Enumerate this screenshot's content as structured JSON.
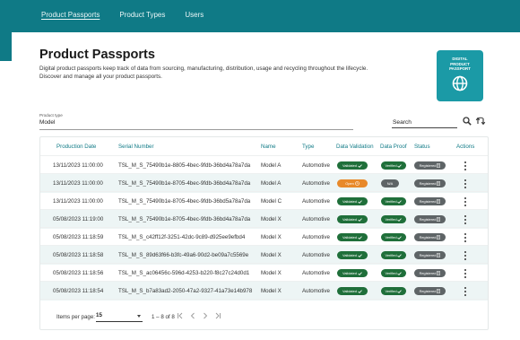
{
  "nav": {
    "items": [
      {
        "label": "Product Passports",
        "active": true
      },
      {
        "label": "Product Types",
        "active": false
      },
      {
        "label": "Users",
        "active": false
      }
    ]
  },
  "header": {
    "title": "Product Passports",
    "desc_line1": "Digital product passports keep track of data from sourcing, manufacturing, distribution, usage and recycling throughout the lifecycle.",
    "desc_line2": "Discover and manage all your product passports."
  },
  "badge": {
    "line1": "DIGITAL",
    "line2": "PRODUCT",
    "line3": "PASSPORT",
    "icon": "globe-icon"
  },
  "filter": {
    "label": "Product type",
    "value": "Model"
  },
  "search": {
    "placeholder": "Search",
    "search_icon": "search-icon",
    "refresh_icon": "refresh-icon"
  },
  "table": {
    "headers": [
      "Production Date",
      "Serial Number",
      "Name",
      "Type",
      "Data Validation",
      "Data Proof",
      "Status",
      "Actions"
    ],
    "rows": [
      {
        "date": "13/11/2023 11:00:00",
        "serial": "TSL_M_S_75490b1e-8805-4bec-9fdb-36bd4a78a7da",
        "name": "Model A",
        "type": "Automotive",
        "validation": "Validated",
        "validation_state": "ok",
        "proof": "Verified",
        "status": "Registered"
      },
      {
        "date": "13/11/2023 11:00:00",
        "serial": "TSL_M_S_75490b1e-8705-4bec-9fdb-36bd4a78a7da",
        "name": "Model A",
        "type": "Automotive",
        "validation": "Open",
        "validation_state": "open",
        "proof": "N/A",
        "status": "Registered"
      },
      {
        "date": "13/11/2023 11:00:00",
        "serial": "TSL_M_S_75490b1e-8705-4bec-9fdb-36bd5a78a7da",
        "name": "Model C",
        "type": "Automotive",
        "validation": "Validated",
        "validation_state": "ok",
        "proof": "Verified",
        "status": "Registered"
      },
      {
        "date": "05/08/2023 11:19:00",
        "serial": "TSL_M_S_75490b1e-8705-4bec-9fdb-36bd4a78a7da",
        "name": "Model X",
        "type": "Automotive",
        "validation": "Validated",
        "validation_state": "ok",
        "proof": "Verified",
        "status": "Registered"
      },
      {
        "date": "05/08/2023 11:18:59",
        "serial": "TSL_M_S_c42ff12f-3251-42dc-9c89-d925ee9efbd4",
        "name": "Model X",
        "type": "Automotive",
        "validation": "Validated",
        "validation_state": "ok",
        "proof": "Verified",
        "status": "Registered"
      },
      {
        "date": "05/08/2023 11:18:58",
        "serial": "TSL_M_S_89d63f66-b3fc-49a6-90d2-be09a7c5569e",
        "name": "Model X",
        "type": "Automotive",
        "validation": "Validated",
        "validation_state": "ok",
        "proof": "Verified",
        "status": "Registered"
      },
      {
        "date": "05/08/2023 11:18:56",
        "serial": "TSL_M_S_ac06456c-596d-4253-b220-f8c27c24d0d1",
        "name": "Model X",
        "type": "Automotive",
        "validation": "Validated",
        "validation_state": "ok",
        "proof": "Verified",
        "status": "Registered"
      },
      {
        "date": "05/08/2023 11:18:54",
        "serial": "TSL_M_S_b7a83ad2-2050-47a2-9327-41a73e14b978",
        "name": "Model X",
        "type": "Automotive",
        "validation": "Validated",
        "validation_state": "ok",
        "proof": "Verified",
        "status": "Registered"
      }
    ]
  },
  "pagination": {
    "items_per_page_label": "Items per page:",
    "items_per_page_value": "15",
    "range": "1 – 8 of 8",
    "first_icon": "first-page-icon",
    "prev_icon": "prev-page-icon",
    "next_icon": "next-page-icon",
    "last_icon": "last-page-icon"
  },
  "colors": {
    "brand": "#0f7a86",
    "badge": "#1b9aa6",
    "validated": "#1f6f3a",
    "open": "#e8892a",
    "registered": "#5e6466",
    "row_alt": "#edf5f5"
  }
}
